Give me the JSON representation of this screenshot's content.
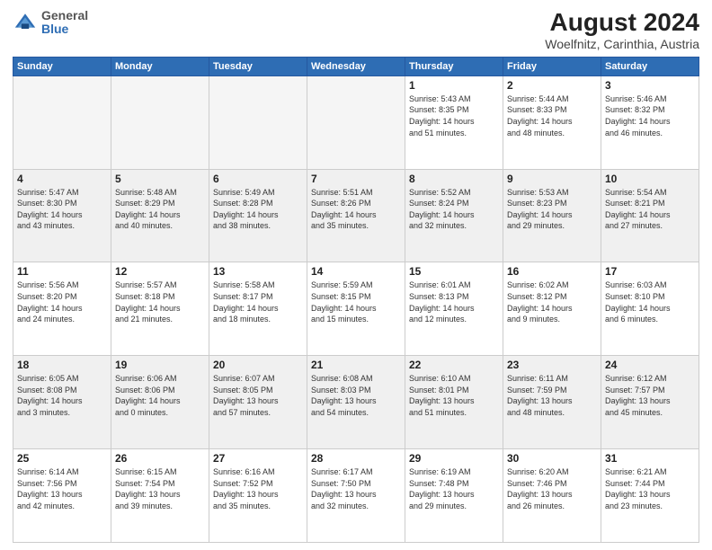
{
  "header": {
    "title": "August 2024",
    "subtitle": "Woelfnitz, Carinthia, Austria",
    "logo_line1": "General",
    "logo_line2": "Blue"
  },
  "weekdays": [
    "Sunday",
    "Monday",
    "Tuesday",
    "Wednesday",
    "Thursday",
    "Friday",
    "Saturday"
  ],
  "weeks": [
    [
      {
        "day": "",
        "info": "",
        "empty": true
      },
      {
        "day": "",
        "info": "",
        "empty": true
      },
      {
        "day": "",
        "info": "",
        "empty": true
      },
      {
        "day": "",
        "info": "",
        "empty": true
      },
      {
        "day": "1",
        "info": "Sunrise: 5:43 AM\nSunset: 8:35 PM\nDaylight: 14 hours\nand 51 minutes."
      },
      {
        "day": "2",
        "info": "Sunrise: 5:44 AM\nSunset: 8:33 PM\nDaylight: 14 hours\nand 48 minutes."
      },
      {
        "day": "3",
        "info": "Sunrise: 5:46 AM\nSunset: 8:32 PM\nDaylight: 14 hours\nand 46 minutes."
      }
    ],
    [
      {
        "day": "4",
        "info": "Sunrise: 5:47 AM\nSunset: 8:30 PM\nDaylight: 14 hours\nand 43 minutes."
      },
      {
        "day": "5",
        "info": "Sunrise: 5:48 AM\nSunset: 8:29 PM\nDaylight: 14 hours\nand 40 minutes."
      },
      {
        "day": "6",
        "info": "Sunrise: 5:49 AM\nSunset: 8:28 PM\nDaylight: 14 hours\nand 38 minutes."
      },
      {
        "day": "7",
        "info": "Sunrise: 5:51 AM\nSunset: 8:26 PM\nDaylight: 14 hours\nand 35 minutes."
      },
      {
        "day": "8",
        "info": "Sunrise: 5:52 AM\nSunset: 8:24 PM\nDaylight: 14 hours\nand 32 minutes."
      },
      {
        "day": "9",
        "info": "Sunrise: 5:53 AM\nSunset: 8:23 PM\nDaylight: 14 hours\nand 29 minutes."
      },
      {
        "day": "10",
        "info": "Sunrise: 5:54 AM\nSunset: 8:21 PM\nDaylight: 14 hours\nand 27 minutes."
      }
    ],
    [
      {
        "day": "11",
        "info": "Sunrise: 5:56 AM\nSunset: 8:20 PM\nDaylight: 14 hours\nand 24 minutes."
      },
      {
        "day": "12",
        "info": "Sunrise: 5:57 AM\nSunset: 8:18 PM\nDaylight: 14 hours\nand 21 minutes."
      },
      {
        "day": "13",
        "info": "Sunrise: 5:58 AM\nSunset: 8:17 PM\nDaylight: 14 hours\nand 18 minutes."
      },
      {
        "day": "14",
        "info": "Sunrise: 5:59 AM\nSunset: 8:15 PM\nDaylight: 14 hours\nand 15 minutes."
      },
      {
        "day": "15",
        "info": "Sunrise: 6:01 AM\nSunset: 8:13 PM\nDaylight: 14 hours\nand 12 minutes."
      },
      {
        "day": "16",
        "info": "Sunrise: 6:02 AM\nSunset: 8:12 PM\nDaylight: 14 hours\nand 9 minutes."
      },
      {
        "day": "17",
        "info": "Sunrise: 6:03 AM\nSunset: 8:10 PM\nDaylight: 14 hours\nand 6 minutes."
      }
    ],
    [
      {
        "day": "18",
        "info": "Sunrise: 6:05 AM\nSunset: 8:08 PM\nDaylight: 14 hours\nand 3 minutes."
      },
      {
        "day": "19",
        "info": "Sunrise: 6:06 AM\nSunset: 8:06 PM\nDaylight: 14 hours\nand 0 minutes."
      },
      {
        "day": "20",
        "info": "Sunrise: 6:07 AM\nSunset: 8:05 PM\nDaylight: 13 hours\nand 57 minutes."
      },
      {
        "day": "21",
        "info": "Sunrise: 6:08 AM\nSunset: 8:03 PM\nDaylight: 13 hours\nand 54 minutes."
      },
      {
        "day": "22",
        "info": "Sunrise: 6:10 AM\nSunset: 8:01 PM\nDaylight: 13 hours\nand 51 minutes."
      },
      {
        "day": "23",
        "info": "Sunrise: 6:11 AM\nSunset: 7:59 PM\nDaylight: 13 hours\nand 48 minutes."
      },
      {
        "day": "24",
        "info": "Sunrise: 6:12 AM\nSunset: 7:57 PM\nDaylight: 13 hours\nand 45 minutes."
      }
    ],
    [
      {
        "day": "25",
        "info": "Sunrise: 6:14 AM\nSunset: 7:56 PM\nDaylight: 13 hours\nand 42 minutes."
      },
      {
        "day": "26",
        "info": "Sunrise: 6:15 AM\nSunset: 7:54 PM\nDaylight: 13 hours\nand 39 minutes."
      },
      {
        "day": "27",
        "info": "Sunrise: 6:16 AM\nSunset: 7:52 PM\nDaylight: 13 hours\nand 35 minutes."
      },
      {
        "day": "28",
        "info": "Sunrise: 6:17 AM\nSunset: 7:50 PM\nDaylight: 13 hours\nand 32 minutes."
      },
      {
        "day": "29",
        "info": "Sunrise: 6:19 AM\nSunset: 7:48 PM\nDaylight: 13 hours\nand 29 minutes."
      },
      {
        "day": "30",
        "info": "Sunrise: 6:20 AM\nSunset: 7:46 PM\nDaylight: 13 hours\nand 26 minutes."
      },
      {
        "day": "31",
        "info": "Sunrise: 6:21 AM\nSunset: 7:44 PM\nDaylight: 13 hours\nand 23 minutes."
      }
    ]
  ]
}
